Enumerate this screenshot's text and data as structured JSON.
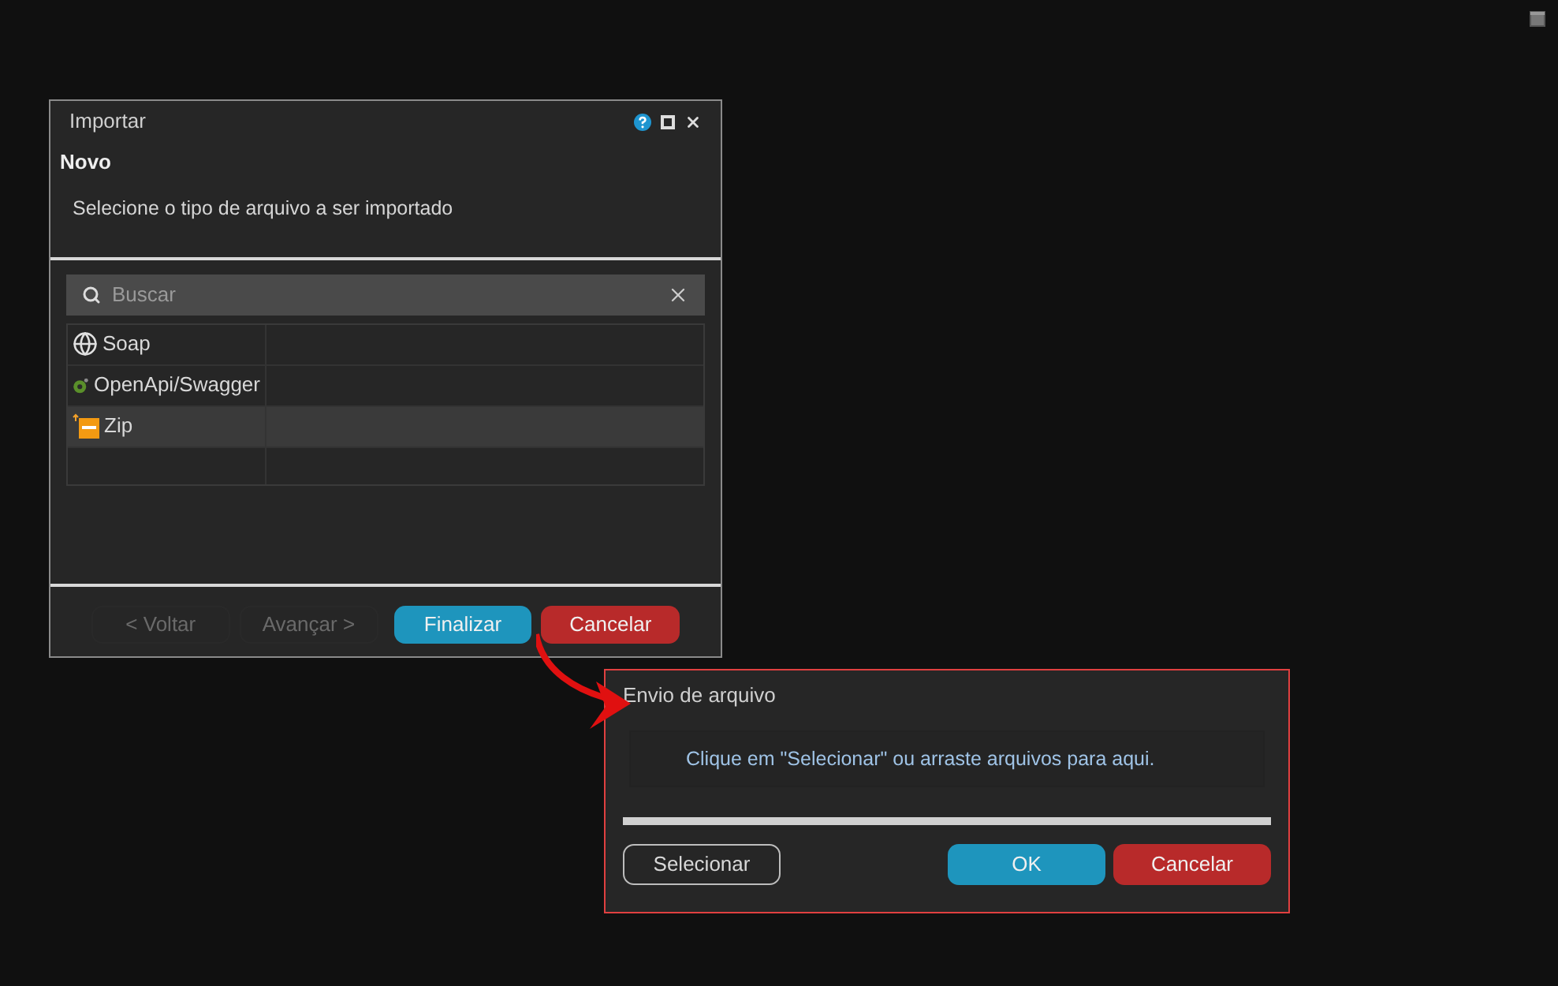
{
  "import_dialog": {
    "title": "Importar",
    "heading": "Novo",
    "instruction": "Selecione o tipo de arquivo a ser importado",
    "search": {
      "placeholder": "Buscar"
    },
    "items": [
      {
        "kind": "globe",
        "label": "Soap",
        "selected": false
      },
      {
        "kind": "openapi",
        "label": "OpenApi/Swagger",
        "selected": false
      },
      {
        "kind": "zip",
        "label": "Zip",
        "selected": true
      }
    ],
    "buttons": [
      {
        "kind": "plain",
        "label": "< Voltar",
        "disabled": true
      },
      {
        "kind": "plain",
        "label": "Avançar >",
        "disabled": true
      },
      {
        "kind": "primary",
        "label": "Finalizar",
        "disabled": false
      },
      {
        "kind": "danger",
        "label": "Cancelar",
        "disabled": false
      }
    ]
  },
  "upload_dialog": {
    "title": "Envio de arquivo",
    "drop_hint": "Clique em \"Selecionar\" ou arraste arquivos para aqui.",
    "progress": {
      "level": 1
    },
    "buttons": [
      {
        "kind": "outline",
        "label": "Selecionar"
      },
      {
        "kind": "primary",
        "label": "OK"
      },
      {
        "kind": "danger",
        "label": "Cancelar"
      }
    ]
  }
}
